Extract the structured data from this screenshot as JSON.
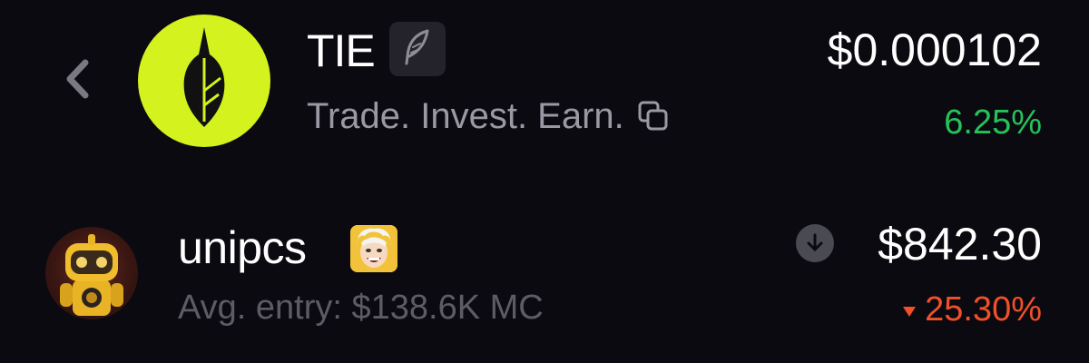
{
  "header": {
    "back_icon": "chevron-left-icon",
    "token": {
      "name": "TIE",
      "badge_icon": "feather-icon",
      "tagline": "Trade. Invest. Earn.",
      "copy_icon": "copy-icon",
      "price": "$0.000102",
      "change": "6.25%",
      "change_color": "#25c35a",
      "logo_background": "#d4f21e"
    }
  },
  "holding": {
    "username": "unipcs",
    "avg_entry": "Avg. entry: $138.6K MC",
    "status_icon": "arrow-down-circle-icon",
    "value": "$842.30",
    "change": "25.30%",
    "change_direction": "down",
    "change_color": "#f0502a"
  }
}
